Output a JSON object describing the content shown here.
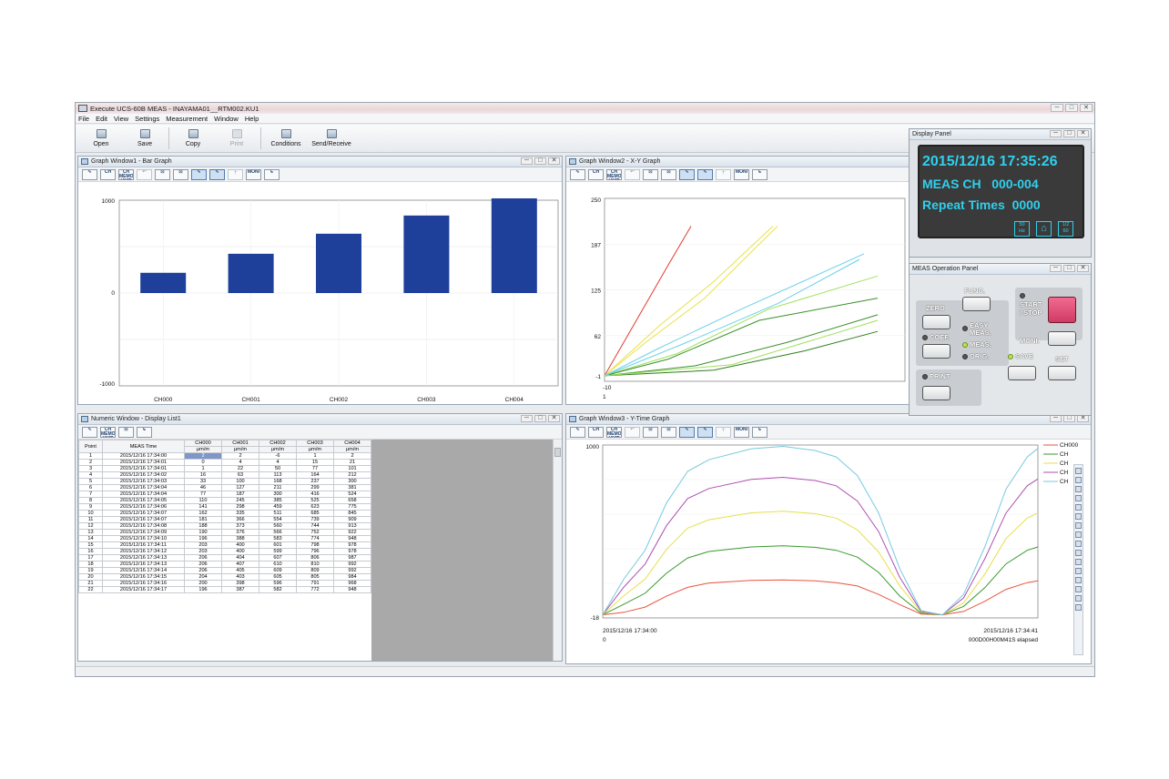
{
  "window": {
    "title": "Execute UCS-60B MEAS - INAYAMA01__RTM002.KU1",
    "win_buttons": [
      "─",
      "□",
      "✕"
    ]
  },
  "menu": [
    "File",
    "Edit",
    "View",
    "Settings",
    "Measurement",
    "Window",
    "Help"
  ],
  "toolbar": [
    {
      "label": "Open",
      "icon": "open-folder-icon"
    },
    {
      "label": "Save",
      "icon": "floppy-disk-icon"
    },
    {
      "label": "Copy",
      "icon": "copy-icon"
    },
    {
      "label": "Print",
      "icon": "printer-icon"
    },
    {
      "label": "Conditions",
      "icon": "conditions-icon"
    },
    {
      "label": "Send/Receive",
      "icon": "send-receive-icon"
    }
  ],
  "graph_tools": [
    "∿",
    "CH",
    "CH MEMO UNIT",
    "↶",
    "⊡",
    "⊡",
    "∿",
    "∿",
    "┼",
    "MONI",
    "↳"
  ],
  "bar_window": {
    "title": "Graph Window1 - Bar Graph",
    "chart_data": {
      "type": "bar",
      "categories": [
        "CH000",
        "CH001",
        "CH002",
        "CH003",
        "CH004"
      ],
      "values": [
        218,
        423,
        639,
        835,
        1020
      ],
      "ylim": [
        -1000,
        1000
      ],
      "yticks": [
        "1000",
        "0",
        "-1000"
      ],
      "bar_color": "#1e3f9a",
      "grid": true
    }
  },
  "xy_window": {
    "title": "Graph Window2 - X-Y Graph",
    "chart_data": {
      "type": "line",
      "yticks": [
        "250",
        "187",
        "125",
        "62",
        "-1"
      ],
      "xticks": [
        "-10"
      ],
      "x_sub_label": "1",
      "grid": true,
      "series": [
        {
          "color": "#e53a2e",
          "points": [
            [
              0,
              0
            ],
            [
              35,
              100
            ],
            [
              70,
              200
            ],
            [
              95,
              270
            ]
          ]
        },
        {
          "color": "#e8e24b",
          "points": [
            [
              0,
              0
            ],
            [
              60,
              90
            ],
            [
              120,
              170
            ],
            [
              185,
              270
            ]
          ]
        },
        {
          "color": "#e8e24b",
          "points": [
            [
              0,
              0
            ],
            [
              45,
              60
            ],
            [
              110,
              140
            ],
            [
              190,
              270
            ]
          ]
        },
        {
          "color": "#9ee05a",
          "points": [
            [
              0,
              0
            ],
            [
              80,
              40
            ],
            [
              180,
              120
            ],
            [
              300,
              180
            ]
          ]
        },
        {
          "color": "#3a8f2a",
          "points": [
            [
              0,
              0
            ],
            [
              70,
              30
            ],
            [
              170,
              100
            ],
            [
              300,
              140
            ]
          ]
        },
        {
          "color": "#3a8f2a",
          "points": [
            [
              0,
              0
            ],
            [
              100,
              18
            ],
            [
              200,
              60
            ],
            [
              300,
              110
            ]
          ]
        },
        {
          "color": "#2e7d1e",
          "points": [
            [
              0,
              0
            ],
            [
              120,
              10
            ],
            [
              220,
              45
            ],
            [
              300,
              80
            ]
          ]
        },
        {
          "color": "#6ad0e8",
          "points": [
            [
              0,
              0
            ],
            [
              60,
              50
            ],
            [
              150,
              120
            ],
            [
              285,
              220
            ]
          ]
        },
        {
          "color": "#6ad0e8",
          "points": [
            [
              0,
              0
            ],
            [
              90,
              60
            ],
            [
              190,
              130
            ],
            [
              280,
              210
            ]
          ]
        },
        {
          "color": "#9ee05a",
          "points": [
            [
              0,
              0
            ],
            [
              140,
              20
            ],
            [
              240,
              70
            ],
            [
              300,
              100
            ]
          ]
        }
      ],
      "xlim": [
        0,
        330
      ],
      "ylim": [
        -10,
        320
      ]
    }
  },
  "list_window": {
    "title": "Numeric Window - Display List1",
    "col_point": "Point",
    "col_time": "MEAS Time",
    "channels": [
      "CH000",
      "CH001",
      "CH002",
      "CH003",
      "CH004"
    ],
    "unit": "μm/m",
    "rows": [
      [
        "1",
        "2015/12/16 17:34:00",
        "2",
        "2",
        "-6",
        "1",
        "2"
      ],
      [
        "2",
        "2015/12/16 17:34:01",
        "0",
        "4",
        "4",
        "15",
        "21"
      ],
      [
        "3",
        "2015/12/16 17:34:01",
        "1",
        "22",
        "50",
        "77",
        "101"
      ],
      [
        "4",
        "2015/12/16 17:34:02",
        "16",
        "63",
        "113",
        "164",
        "212"
      ],
      [
        "5",
        "2015/12/16 17:34:03",
        "33",
        "100",
        "168",
        "237",
        "300"
      ],
      [
        "6",
        "2015/12/16 17:34:04",
        "46",
        "127",
        "211",
        "299",
        "381"
      ],
      [
        "7",
        "2015/12/16 17:34:04",
        "77",
        "187",
        "300",
        "416",
        "524"
      ],
      [
        "8",
        "2015/12/16 17:34:05",
        "110",
        "245",
        "385",
        "525",
        "658"
      ],
      [
        "9",
        "2015/12/16 17:34:06",
        "141",
        "298",
        "459",
        "623",
        "775"
      ],
      [
        "10",
        "2015/12/16 17:34:07",
        "162",
        "335",
        "511",
        "685",
        "845"
      ],
      [
        "11",
        "2015/12/16 17:34:07",
        "181",
        "366",
        "554",
        "739",
        "909"
      ],
      [
        "12",
        "2015/12/16 17:34:08",
        "188",
        "373",
        "560",
        "744",
        "913"
      ],
      [
        "13",
        "2015/12/16 17:34:09",
        "190",
        "376",
        "566",
        "752",
        "922"
      ],
      [
        "14",
        "2015/12/16 17:34:10",
        "196",
        "388",
        "583",
        "774",
        "948"
      ],
      [
        "15",
        "2015/12/16 17:34:11",
        "203",
        "400",
        "601",
        "798",
        "978"
      ],
      [
        "16",
        "2015/12/16 17:34:12",
        "203",
        "400",
        "599",
        "796",
        "978"
      ],
      [
        "17",
        "2015/12/16 17:34:13",
        "206",
        "404",
        "607",
        "806",
        "987"
      ],
      [
        "18",
        "2015/12/16 17:34:13",
        "206",
        "407",
        "610",
        "810",
        "992"
      ],
      [
        "19",
        "2015/12/16 17:34:14",
        "206",
        "405",
        "609",
        "809",
        "992"
      ],
      [
        "20",
        "2015/12/16 17:34:15",
        "204",
        "403",
        "605",
        "805",
        "984"
      ],
      [
        "21",
        "2015/12/16 17:34:16",
        "200",
        "398",
        "596",
        "791",
        "968"
      ],
      [
        "22",
        "2015/12/16 17:34:17",
        "196",
        "387",
        "582",
        "772",
        "948"
      ]
    ]
  },
  "ytime_window": {
    "title": "Graph Window3 - Y-Time Graph",
    "chart_data": {
      "type": "line",
      "yticks": [
        "1000",
        "-18"
      ],
      "x_start_time": "2015/12/16 17:34:00",
      "x_start_label": "0",
      "x_end_time": "2015/12/16 17:34:41",
      "x_end_label": "000D00H00M41S elapsed",
      "legend_position": "top-right",
      "legend": [
        "CH000",
        "CH",
        "CH",
        "CH",
        "CH"
      ],
      "xlim": [
        0,
        41
      ],
      "ylim": [
        -18,
        1000
      ],
      "grid": true,
      "series": [
        {
          "color": "#e8553f",
          "points": [
            [
              0,
              0
            ],
            [
              2,
              15
            ],
            [
              4,
              46
            ],
            [
              6,
              110
            ],
            [
              8,
              162
            ],
            [
              10,
              188
            ],
            [
              14,
              203
            ],
            [
              17,
              206
            ],
            [
              20,
              200
            ],
            [
              22,
              190
            ],
            [
              24,
              170
            ],
            [
              26,
              120
            ],
            [
              28,
              60
            ],
            [
              30,
              5
            ],
            [
              32,
              0
            ],
            [
              34,
              20
            ],
            [
              36,
              80
            ],
            [
              38,
              150
            ],
            [
              40,
              190
            ],
            [
              41,
              200
            ]
          ]
        },
        {
          "color": "#3a9a2e",
          "points": [
            [
              0,
              0
            ],
            [
              2,
              63
            ],
            [
              4,
              127
            ],
            [
              6,
              245
            ],
            [
              8,
              335
            ],
            [
              10,
              373
            ],
            [
              14,
              400
            ],
            [
              17,
              407
            ],
            [
              20,
              398
            ],
            [
              22,
              380
            ],
            [
              24,
              340
            ],
            [
              26,
              250
            ],
            [
              28,
              110
            ],
            [
              30,
              10
            ],
            [
              32,
              0
            ],
            [
              34,
              50
            ],
            [
              36,
              160
            ],
            [
              38,
              300
            ],
            [
              40,
              380
            ],
            [
              41,
              400
            ]
          ]
        },
        {
          "color": "#e6e04a",
          "points": [
            [
              0,
              0
            ],
            [
              2,
              113
            ],
            [
              4,
              211
            ],
            [
              6,
              385
            ],
            [
              8,
              511
            ],
            [
              10,
              560
            ],
            [
              14,
              601
            ],
            [
              17,
              610
            ],
            [
              20,
              596
            ],
            [
              22,
              570
            ],
            [
              24,
              500
            ],
            [
              26,
              370
            ],
            [
              28,
              170
            ],
            [
              30,
              15
            ],
            [
              32,
              0
            ],
            [
              34,
              70
            ],
            [
              36,
              240
            ],
            [
              38,
              450
            ],
            [
              40,
              570
            ],
            [
              41,
              600
            ]
          ]
        },
        {
          "color": "#b04fb0",
          "points": [
            [
              0,
              0
            ],
            [
              2,
              164
            ],
            [
              4,
              299
            ],
            [
              6,
              525
            ],
            [
              8,
              685
            ],
            [
              10,
              744
            ],
            [
              14,
              798
            ],
            [
              17,
              810
            ],
            [
              20,
              791
            ],
            [
              22,
              760
            ],
            [
              24,
              670
            ],
            [
              26,
              490
            ],
            [
              28,
              220
            ],
            [
              30,
              20
            ],
            [
              32,
              0
            ],
            [
              34,
              100
            ],
            [
              36,
              330
            ],
            [
              38,
              600
            ],
            [
              40,
              760
            ],
            [
              41,
              800
            ]
          ]
        },
        {
          "color": "#78c9e0",
          "points": [
            [
              0,
              0
            ],
            [
              2,
              212
            ],
            [
              4,
              381
            ],
            [
              6,
              658
            ],
            [
              8,
              845
            ],
            [
              10,
              913
            ],
            [
              14,
              978
            ],
            [
              17,
              992
            ],
            [
              20,
              968
            ],
            [
              22,
              930
            ],
            [
              24,
              820
            ],
            [
              26,
              600
            ],
            [
              28,
              270
            ],
            [
              30,
              25
            ],
            [
              32,
              0
            ],
            [
              34,
              120
            ],
            [
              36,
              400
            ],
            [
              38,
              740
            ],
            [
              40,
              930
            ],
            [
              41,
              980
            ]
          ]
        }
      ]
    }
  },
  "display_panel": {
    "title": "Display Panel",
    "datetime": "2015/12/16 17:35:26",
    "meas_ch_label": "MEAS CH",
    "meas_ch": "000-004",
    "repeat_label": "Repeat Times",
    "repeat": "0000",
    "icon_freq": [
      "50",
      "Hz"
    ],
    "icon_net": "⌂",
    "icon_rate": [
      "1/2",
      "60"
    ]
  },
  "op_panel": {
    "title": "MEAS Operation Panel",
    "zero": "ZERO",
    "func": "FUNC.",
    "start_stop": "START\n/ STOP",
    "easy_meas": "EASY\nMEAS.",
    "coef": "COEF.",
    "meas": "MEAS.",
    "orig": "ORIG.",
    "moni": "MONI.",
    "save": "SAVE",
    "set": "SET",
    "print": "PRINT"
  }
}
